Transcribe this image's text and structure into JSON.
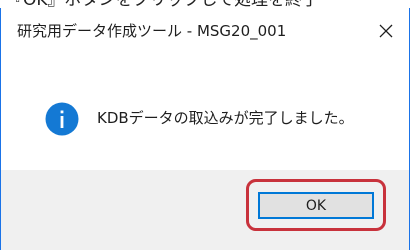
{
  "background_caption": "『OK』ボタンをクリックして処理を終了",
  "dialog": {
    "title": "研究用データ作成ツール - MSG20_001",
    "close_glyph": "✕",
    "message": "KDBデータの取込みが完了しました。",
    "icon": "info-icon",
    "ok_label": "OK"
  },
  "colors": {
    "accent_border": "#1a73e8",
    "info_icon": "#1479d4",
    "highlight": "#c8323c",
    "footer_bg": "#f0f0f0",
    "button_border": "#0078d7"
  }
}
